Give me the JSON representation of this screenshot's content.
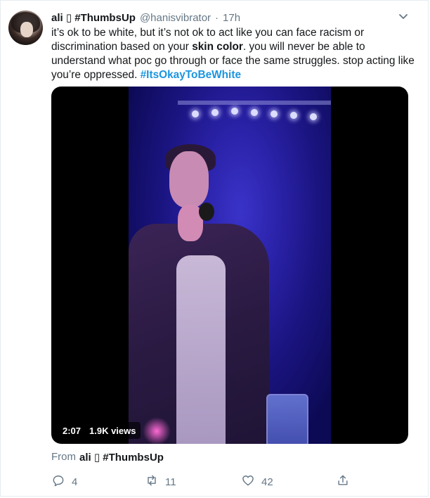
{
  "tweet": {
    "display_name": "ali ▯ #ThumbsUp",
    "handle": "@hanisvibrator",
    "separator": "·",
    "time": "17h",
    "text": {
      "part1": "it’s ok to be white, but it’s not ok to act like you can face racism or discrimination based on your ",
      "bold": "skin color",
      "part2": ". you will never be able to understand what poc go through or face the same struggles. stop acting like you’re oppressed. ",
      "hashtag": "#ItsOkayToBeWhite"
    },
    "media": {
      "duration": "2:07",
      "views": "1.9K views"
    },
    "from": {
      "prefix": "From",
      "source": "ali ▯ #ThumbsUp"
    },
    "actions": {
      "replies": "4",
      "retweets": "11",
      "likes": "42"
    },
    "icons": {
      "menu": "chevron-down-icon",
      "reply": "reply-icon",
      "retweet": "retweet-icon",
      "like": "heart-icon",
      "share": "share-icon"
    },
    "colors": {
      "link": "#1b95e0",
      "muted": "#657786",
      "text": "#14171a",
      "border": "#e6ecf0"
    }
  }
}
